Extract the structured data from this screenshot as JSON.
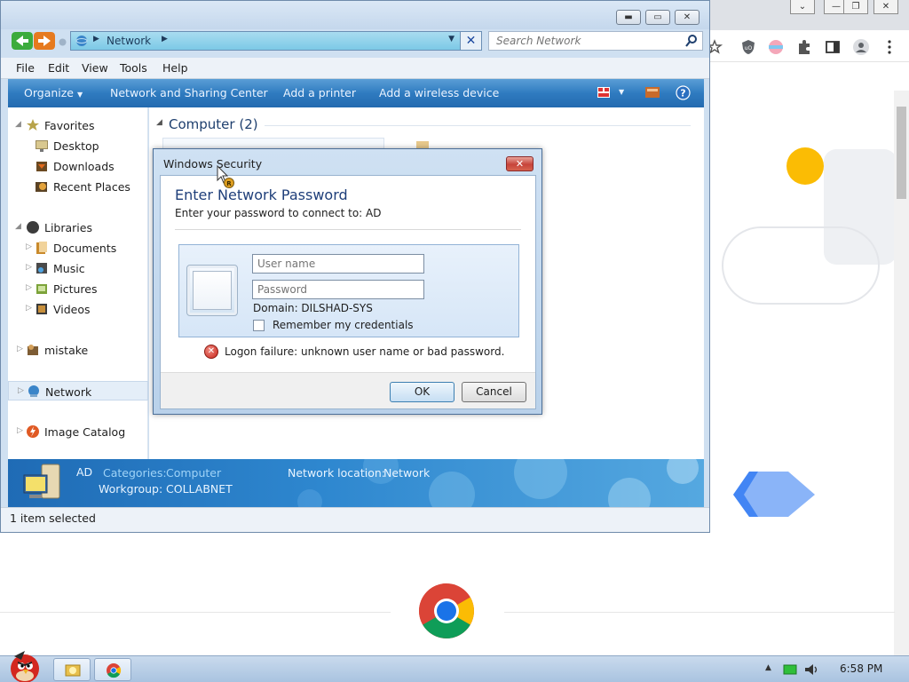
{
  "explorer": {
    "address": "Network",
    "search_placeholder": "Search Network",
    "menu": [
      "File",
      "Edit",
      "View",
      "Tools",
      "Help"
    ],
    "commands": [
      "Organize",
      "Network and Sharing Center",
      "Add a printer",
      "Add a wireless device"
    ],
    "nav": {
      "favorites": "Favorites",
      "desktop": "Desktop",
      "downloads": "Downloads",
      "recent": "Recent Places",
      "libraries": "Libraries",
      "documents": "Documents",
      "music": "Music",
      "pictures": "Pictures",
      "videos": "Videos",
      "mistake": "mistake",
      "network": "Network",
      "image_catalog": "Image Catalog"
    },
    "group_header": "Computer (2)",
    "details": {
      "name": "AD",
      "categories_label": "Categories:",
      "categories_value": "Computer",
      "workgroup_label": "Workgroup:",
      "workgroup_value": "COLLABNET",
      "location_label": "Network location:",
      "location_value": "Network"
    },
    "status": "1 item selected"
  },
  "dialog": {
    "title": "Windows Security",
    "heading": "Enter Network Password",
    "subtitle": "Enter your password to connect to: AD",
    "username_placeholder": "User name",
    "password_placeholder": "Password",
    "domain": "Domain: DILSHAD-SYS",
    "remember": "Remember my credentials",
    "error": "Logon failure: unknown user name or bad password.",
    "ok": "OK",
    "cancel": "Cancel"
  },
  "taskbar": {
    "clock": "6:58 PM"
  },
  "colors": {
    "accent": "#2f7bc0",
    "error": "#c8251b",
    "chrome_yellow": "#fbbc04",
    "chrome_blue": "#4285f4"
  }
}
